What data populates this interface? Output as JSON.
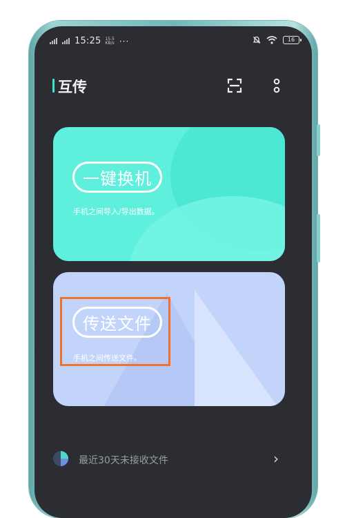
{
  "status_bar": {
    "time": "15:25",
    "speed_value": "15.5",
    "speed_unit": "KB/s",
    "more_dots": "···",
    "battery": "16"
  },
  "header": {
    "title": "互传"
  },
  "cards": [
    {
      "label": "一键换机",
      "description": "手机之间导入/导出数据。"
    },
    {
      "label": "传送文件",
      "description": "手机之间传送文件。"
    }
  ],
  "recent": {
    "label": "最近30天未接收文件",
    "arrow": "›"
  },
  "colors": {
    "accent": "#3ee2cf",
    "card_switch": "#5ef0dd",
    "card_transfer": "#c3d4fb",
    "highlight": "#f0702c"
  }
}
